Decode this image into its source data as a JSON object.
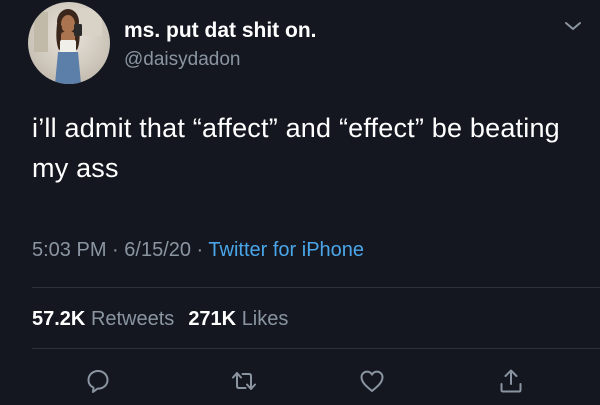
{
  "author": {
    "display_name": "ms. put dat shit on.",
    "handle": "@daisydadon"
  },
  "tweet": {
    "text": "i’ll admit that “affect” and “effect” be beating my ass"
  },
  "meta": {
    "time": "5:03 PM",
    "separator": " · ",
    "date": "6/15/20",
    "source": "Twitter for iPhone"
  },
  "stats": {
    "retweets_count": "57.2K",
    "retweets_label": "Retweets",
    "likes_count": "271K",
    "likes_label": "Likes"
  },
  "icons": {
    "menu": "chevron-down-icon",
    "reply": "reply-icon",
    "retweet": "retweet-icon",
    "like": "heart-icon",
    "share": "share-icon"
  },
  "colors": {
    "background": "#141720",
    "primary_text": "#ffffff",
    "secondary_text": "#8a95a1",
    "link": "#4aa6e8",
    "divider": "#2b313a"
  }
}
